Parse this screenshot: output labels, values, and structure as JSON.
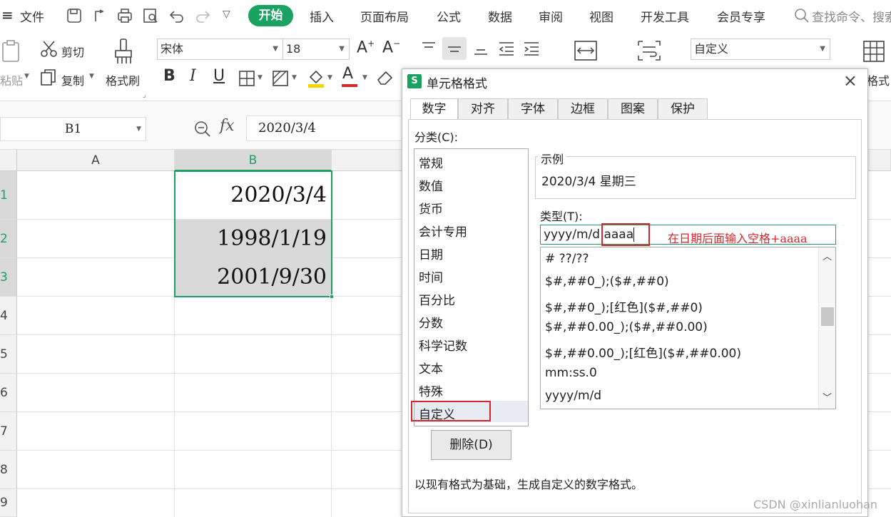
{
  "menubar": {
    "file": "文件",
    "tabs": [
      "开始",
      "插入",
      "页面布局",
      "公式",
      "数据",
      "审阅",
      "视图",
      "开发工具",
      "会员专享"
    ],
    "search_placeholder": "查找命令、搜索"
  },
  "ribbon": {
    "cut": "剪切",
    "paste": "粘贴",
    "copy": "复制",
    "format_painter": "格式刷",
    "font_name": "宋体",
    "font_size": "18",
    "number_format": "自定义",
    "format_cut": "格式"
  },
  "formula_bar": {
    "name_box": "B1",
    "fx": "fx",
    "value": "2020/3/4"
  },
  "sheet": {
    "columns": [
      "A",
      "B"
    ],
    "rows": [
      "1",
      "2",
      "3",
      "4",
      "5",
      "6",
      "7",
      "8",
      "9"
    ],
    "cells": [
      "2020/3/4",
      "1998/1/19",
      "2001/9/30"
    ]
  },
  "dialog": {
    "title": "单元格格式",
    "tabs": [
      "数字",
      "对齐",
      "字体",
      "边框",
      "图案",
      "保护"
    ],
    "category_label": "分类(C):",
    "categories": [
      "常规",
      "数值",
      "货币",
      "会计专用",
      "日期",
      "时间",
      "百分比",
      "分数",
      "科学记数",
      "文本",
      "特殊",
      "自定义"
    ],
    "sample_label": "示例",
    "sample_value": "2020/3/4 星期三",
    "type_label": "类型(T):",
    "type_value": "yyyy/m/d aaaa",
    "formats": [
      "# ??/??",
      "$#,##0_);($#,##0)",
      "$#,##0_);[红色]($#,##0)",
      "$#,##0.00_);($#,##0.00)",
      "$#,##0.00_);[红色]($#,##0.00)",
      "mm:ss.0",
      "yyyy/m/d"
    ],
    "delete_button": "删除(D)",
    "description": "以现有格式为基础，生成自定义的数字格式。"
  },
  "annotation": "在日期后面输入空格+aaaa",
  "watermark": "CSDN @xinlianluohan",
  "colors": {
    "accent": "#1aa260",
    "highlight": "#d9262c",
    "selection": "#d9d9d9"
  }
}
